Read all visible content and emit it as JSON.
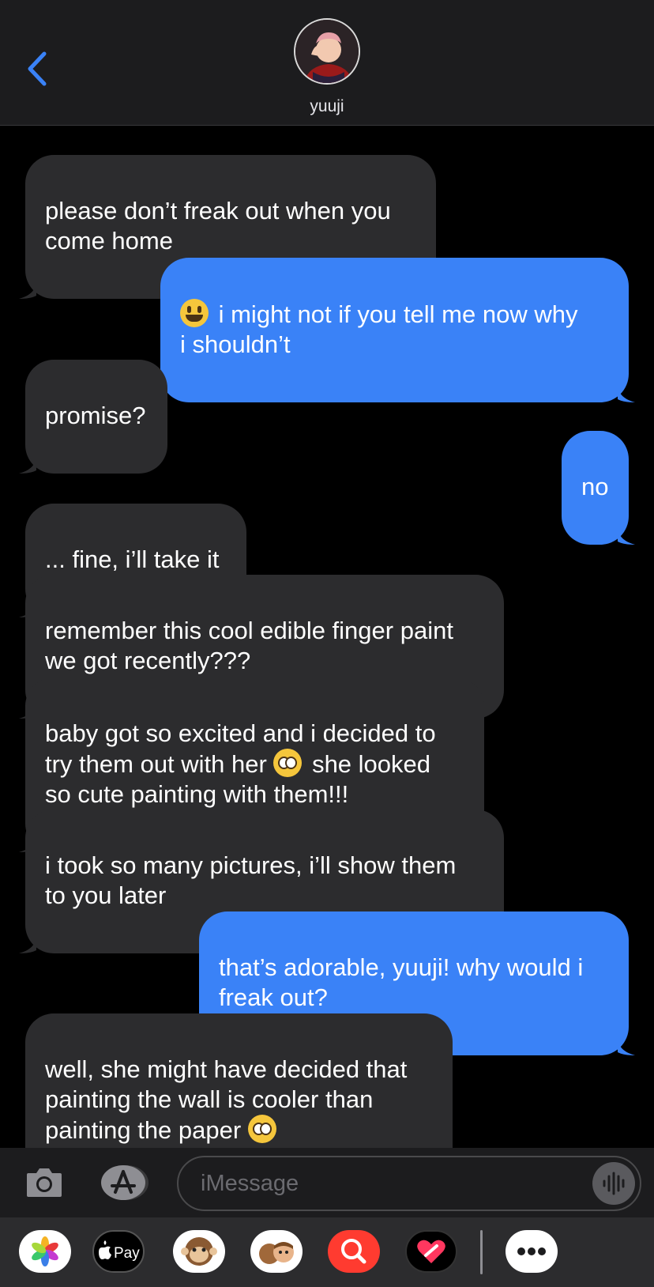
{
  "contact": {
    "name": "yuuji"
  },
  "messages": [
    {
      "side": "in",
      "text": "please don’t freak out when you\ncome home"
    },
    {
      "side": "out",
      "emoji_before": "smile",
      "text": " i might not if you tell me now why\ni shouldn’t"
    },
    {
      "side": "in",
      "text": "promise?"
    },
    {
      "side": "out",
      "text": "no"
    },
    {
      "side": "in",
      "text": "... fine, i’ll take it"
    },
    {
      "side": "in",
      "text": "remember this cool edible finger paint\nwe got recently???"
    },
    {
      "side": "in",
      "text_before": "baby got so excited and i decided to\ntry them out with her ",
      "emoji_mid": "plead",
      "text_after": " she looked\nso cute painting with them!!!"
    },
    {
      "side": "in",
      "text": "i took so many pictures, i’ll show them\nto you later"
    },
    {
      "side": "out",
      "text": "that’s adorable, yuuji! why would i\nfreak out?"
    },
    {
      "side": "in",
      "text_before": "well, she might have decided that\npainting the wall is cooler than\npainting the paper ",
      "emoji_mid": "plead"
    }
  ],
  "input": {
    "placeholder": "iMessage"
  },
  "apps": [
    {
      "name": "photos-app",
      "color": "#ffffff"
    },
    {
      "name": "apple-pay-app",
      "label": "Pay",
      "color": "#000000"
    },
    {
      "name": "memoji-stickers-app",
      "color": "#ffffff"
    },
    {
      "name": "animoji-app",
      "color": "#ffffff"
    },
    {
      "name": "images-search-app",
      "color": "#ff3b30"
    },
    {
      "name": "digital-touch-app",
      "color": "#000000"
    },
    {
      "name": "more-apps",
      "color": "#ffffff"
    }
  ],
  "colors": {
    "incoming": "#2c2c2e",
    "outgoing": "#3a82f7",
    "accent": "#3a82f7"
  }
}
